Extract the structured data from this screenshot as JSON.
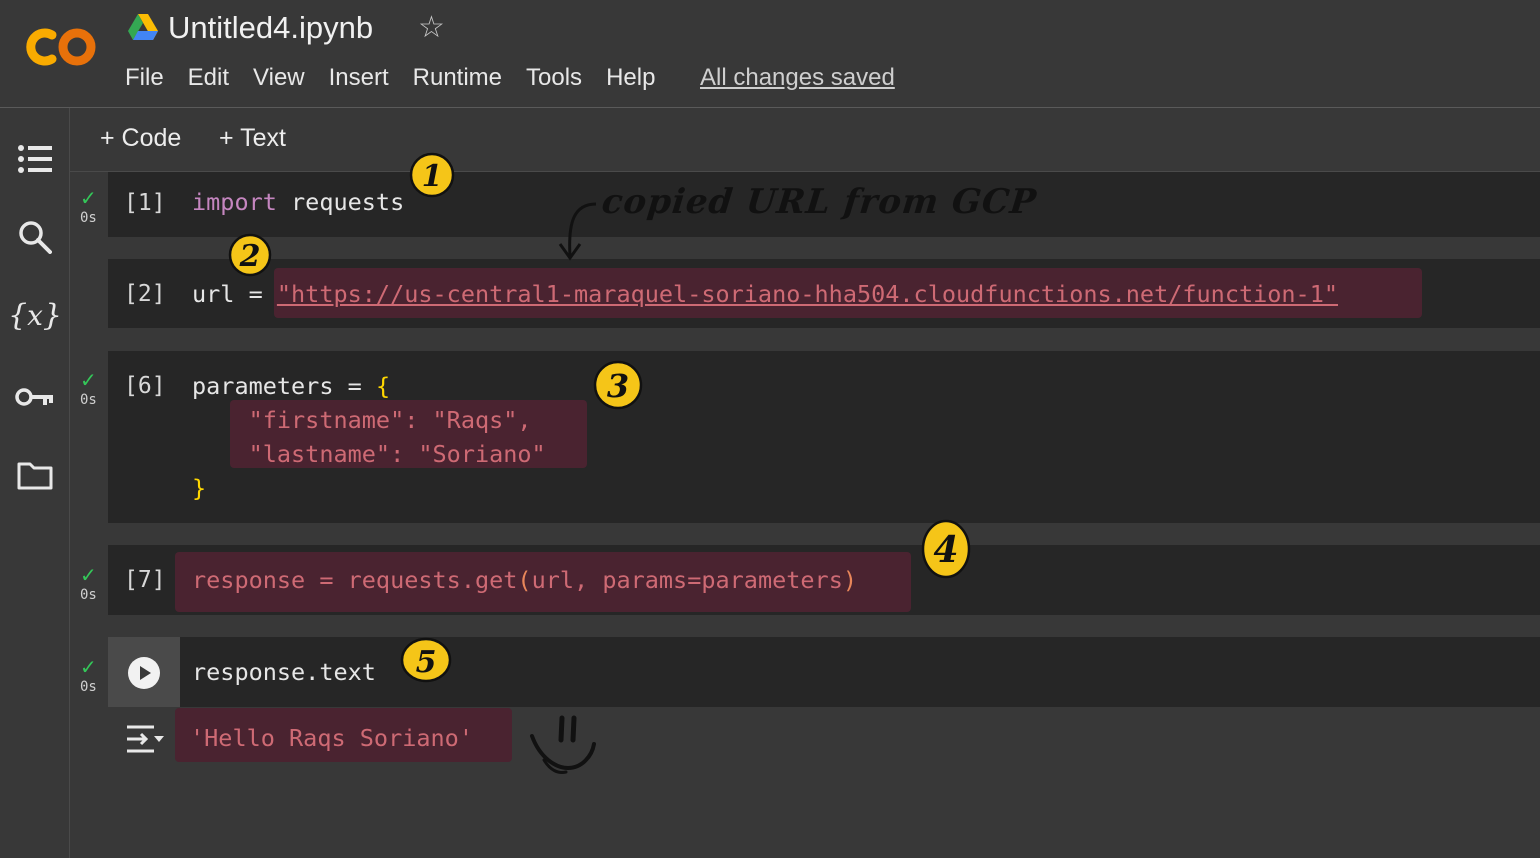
{
  "header": {
    "title": "Untitled4.ipynb",
    "menu": [
      "File",
      "Edit",
      "View",
      "Insert",
      "Runtime",
      "Tools",
      "Help"
    ],
    "save_status": "All changes saved"
  },
  "toolbar": {
    "add_code": "Code",
    "add_text": "Text"
  },
  "cells": [
    {
      "exec": "[1]",
      "duration": "0s",
      "code_kw": "import",
      "code_rest": " requests"
    },
    {
      "exec": "[2]",
      "code_prefix": "url = ",
      "code_url": "\"https://us-central1-maraquel-soriano-hha504.cloudfunctions.net/function-1\""
    },
    {
      "exec": "[6]",
      "duration": "0s",
      "line1": "parameters = ",
      "line1_brace": "{",
      "line2": "    \"firstname\": \"Raqs\",",
      "line3": "    \"lastname\": \"Soriano\"",
      "line4": "}"
    },
    {
      "exec": "[7]",
      "duration": "0s",
      "code_a": "response = requests.get",
      "code_b": "(",
      "code_c": "url, params=parameters",
      "code_d": ")"
    },
    {
      "duration": "0s",
      "code": "response.text",
      "output": "'Hello Raqs Soriano'"
    }
  ],
  "annotations": {
    "copied_note": "copied URL from GCP",
    "n1": "1",
    "n2": "2",
    "n3": "3",
    "n4": "4",
    "n5": "5"
  },
  "colors": {
    "background": "#383838",
    "cell": "#262626",
    "keyword": "#c586c0",
    "string": "#ce6a74",
    "brace": "#ffd700",
    "marker": "#f5c518"
  },
  "icons": [
    "colab-logo",
    "drive-icon",
    "star-icon",
    "toc-icon",
    "search-icon",
    "variables-icon",
    "key-icon",
    "folder-icon",
    "run-icon",
    "output-icon"
  ]
}
